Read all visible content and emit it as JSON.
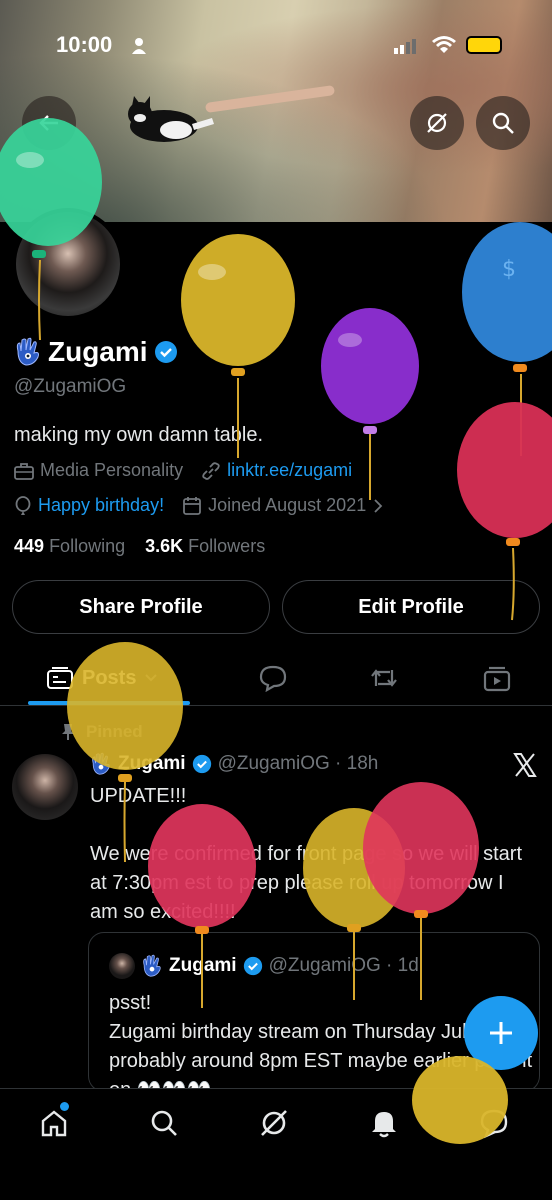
{
  "status_bar": {
    "time": "10:00"
  },
  "profile": {
    "name": "Zugami",
    "handle": "@ZugamiOG",
    "bio": "making my own damn table.",
    "category": "Media Personality",
    "link": "linktr.ee/zugami",
    "birthday": "Happy birthday!",
    "joined": "Joined August 2021",
    "following_count": "449",
    "following_label": "Following",
    "followers_count": "3.6K",
    "followers_label": "Followers"
  },
  "buttons": {
    "share": "Share Profile",
    "edit": "Edit Profile"
  },
  "tabs": {
    "posts": "Posts"
  },
  "post": {
    "pinned_label": "Pinned",
    "author": "Zugami",
    "meta": "@ZugamiOG · 18h",
    "text": "UPDATE!!!\n\nWe were confirmed for front page so we will start at 7:30pm est to prep please roll up tomorrow I am so excited!!!!",
    "quote": {
      "author": "Zugami",
      "meta": "@ZugamiOG · 1d",
      "text": "psst!\nZugami birthday stream on Thursday July 30th probably around 8pm EST maybe earlier pass it on 👀👀👀"
    }
  },
  "colors": {
    "accent": "#1d9bf0",
    "background": "#000000",
    "muted": "#71767b"
  },
  "icons": {
    "nav": [
      "home-icon",
      "search-icon",
      "grok-icon",
      "notifications-icon",
      "messages-icon"
    ],
    "balloons": [
      "green",
      "yellow",
      "purple",
      "blue",
      "red",
      "yellow",
      "red",
      "yellow",
      "red"
    ]
  }
}
